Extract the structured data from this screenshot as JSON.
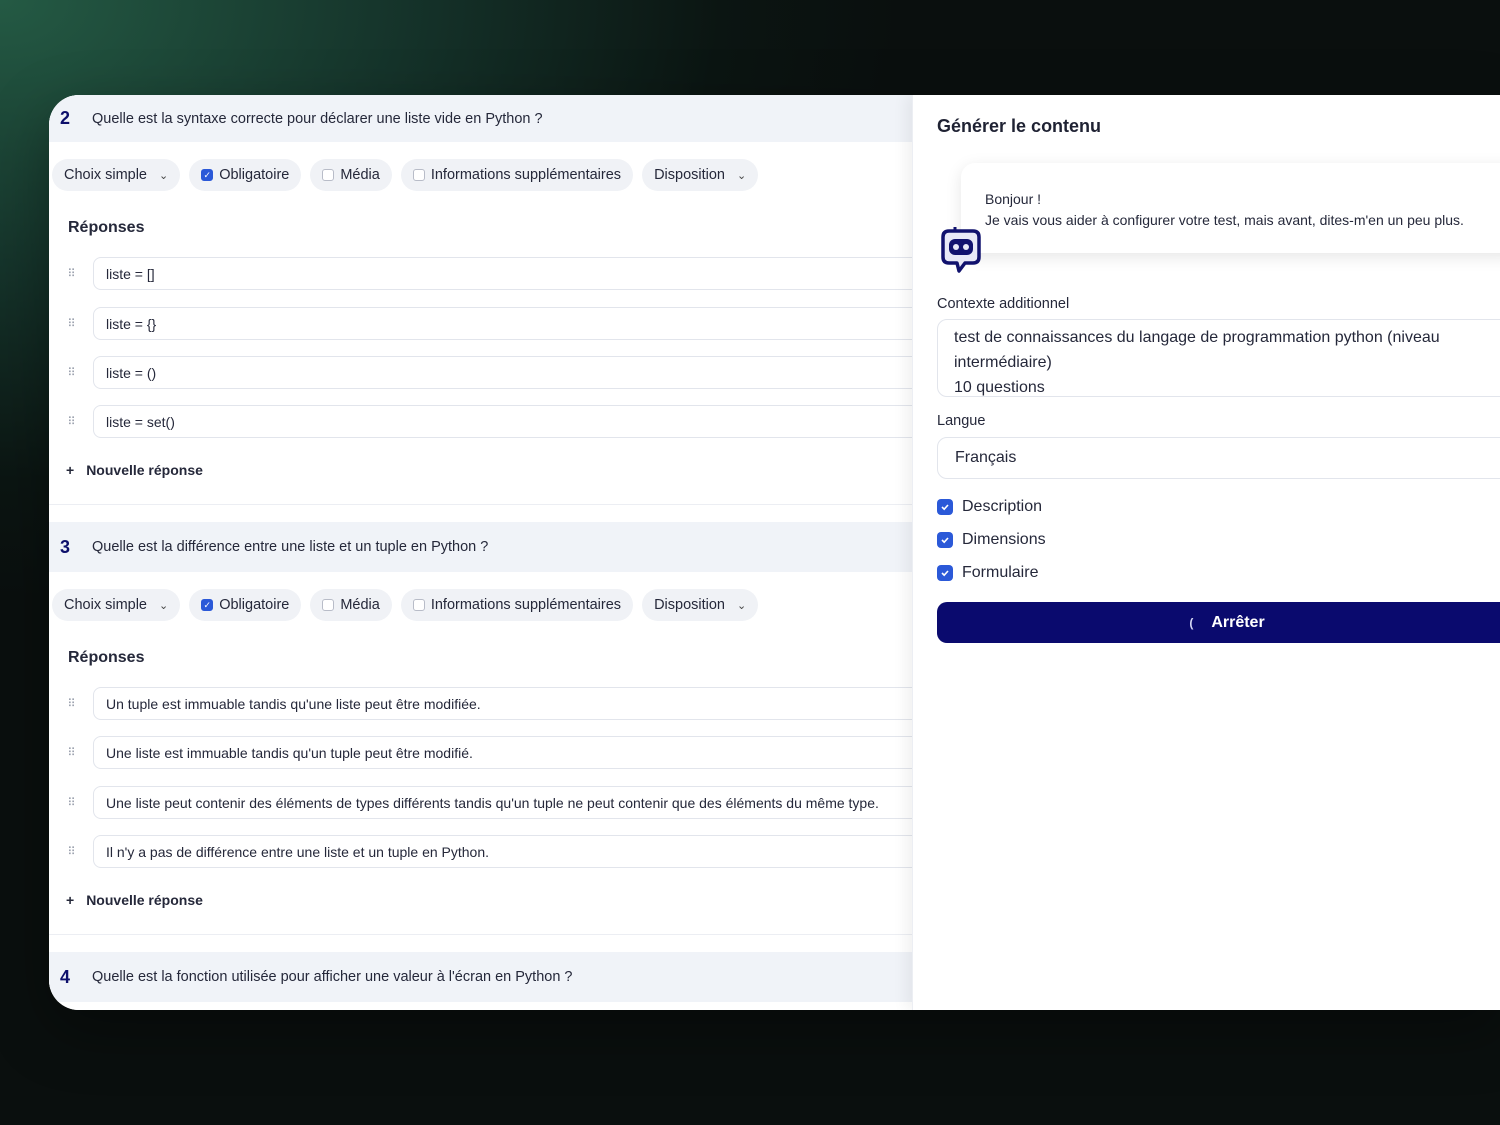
{
  "q2": {
    "number": "2",
    "text": "Quelle est la syntaxe correcte pour déclarer une liste vide en Python ?",
    "answers": [
      "liste = []",
      "liste = {}",
      "liste = ()",
      "liste = set()"
    ]
  },
  "q3": {
    "number": "3",
    "text": "Quelle est la différence entre une liste et un tuple en Python ?",
    "answers": [
      "Un tuple est immuable tandis qu'une liste peut être modifiée.",
      "Une liste est immuable tandis qu'un tuple peut être modifié.",
      "Une liste peut contenir des éléments de types différents tandis qu'un tuple ne peut contenir que des éléments du même type.",
      "Il n'y a pas de différence entre une liste et un tuple en Python."
    ]
  },
  "q4": {
    "number": "4",
    "text": "Quelle est la fonction utilisée pour afficher une valeur à l'écran en Python ?"
  },
  "toolbar": {
    "type_label": "Choix simple",
    "required_label": "Obligatoire",
    "media_label": "Média",
    "extra_info_label": "Informations supplémentaires",
    "layout_label": "Disposition"
  },
  "answers_title": "Réponses",
  "new_answer_label": "Nouvelle réponse",
  "panel": {
    "title": "Générer le contenu",
    "greeting_line1": "Bonjour !",
    "greeting_line2": "Je vais vous aider à configurer votre test, mais avant, dites-m'en un peu plus.",
    "context_label": "Contexte additionnel",
    "context_value": "test de connaissances du langage de programmation python (niveau intermédiaire)\n10 questions",
    "language_label": "Langue",
    "language_value": "Français",
    "options": [
      "Description",
      "Dimensions",
      "Formulaire"
    ],
    "stop_label": "Arrêter"
  },
  "colors": {
    "accent": "#2b59d8",
    "primary_dark": "#0a0a6e",
    "header_bg": "#f0f3f8"
  }
}
